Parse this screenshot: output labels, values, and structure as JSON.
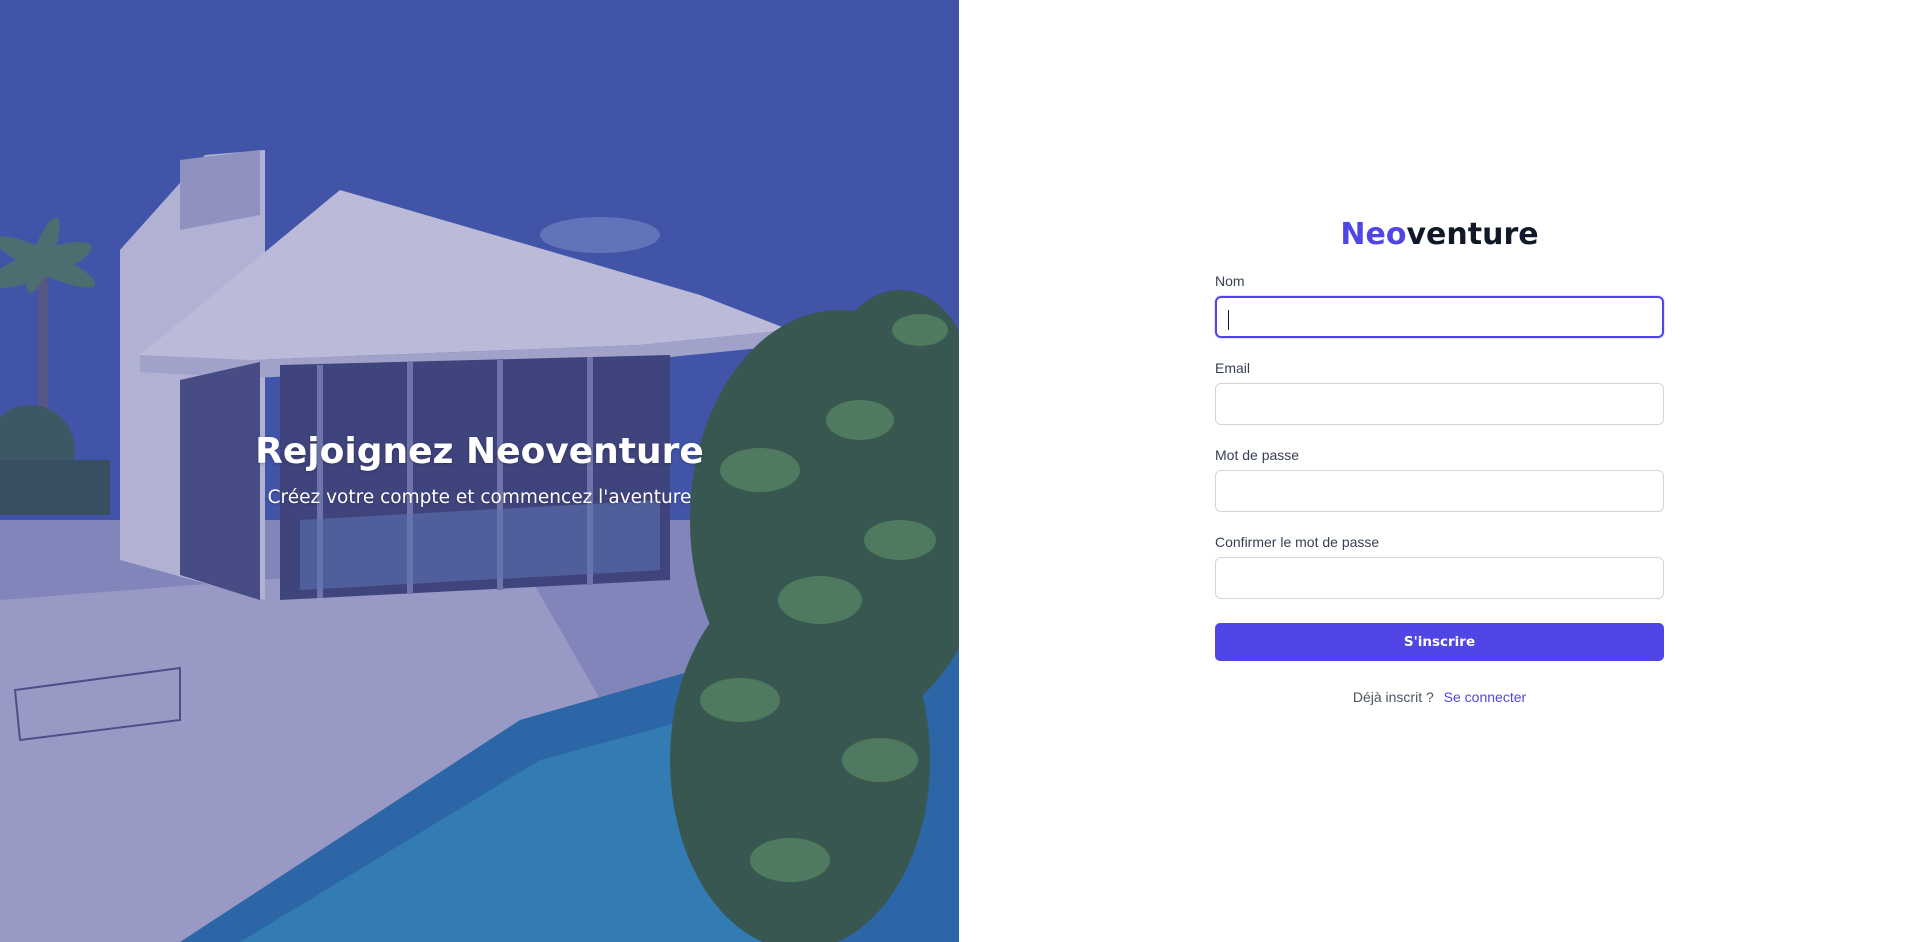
{
  "hero": {
    "title": "Rejoignez Neoventure",
    "subtitle": "Créez votre compte et commencez l'aventure"
  },
  "brand": {
    "accent": "Neo",
    "rest": "venture"
  },
  "form": {
    "fields": [
      {
        "label": "Nom",
        "value": "",
        "focused": true
      },
      {
        "label": "Email",
        "value": ""
      },
      {
        "label": "Mot de passe",
        "value": ""
      },
      {
        "label": "Confirmer le mot de passe",
        "value": ""
      }
    ],
    "submit_label": "S'inscrire"
  },
  "signin": {
    "prompt": "Déjà inscrit ?",
    "link_label": "Se connecter"
  },
  "colors": {
    "accent": "#4f46e5",
    "text_dark": "#111827",
    "label": "#374151"
  }
}
